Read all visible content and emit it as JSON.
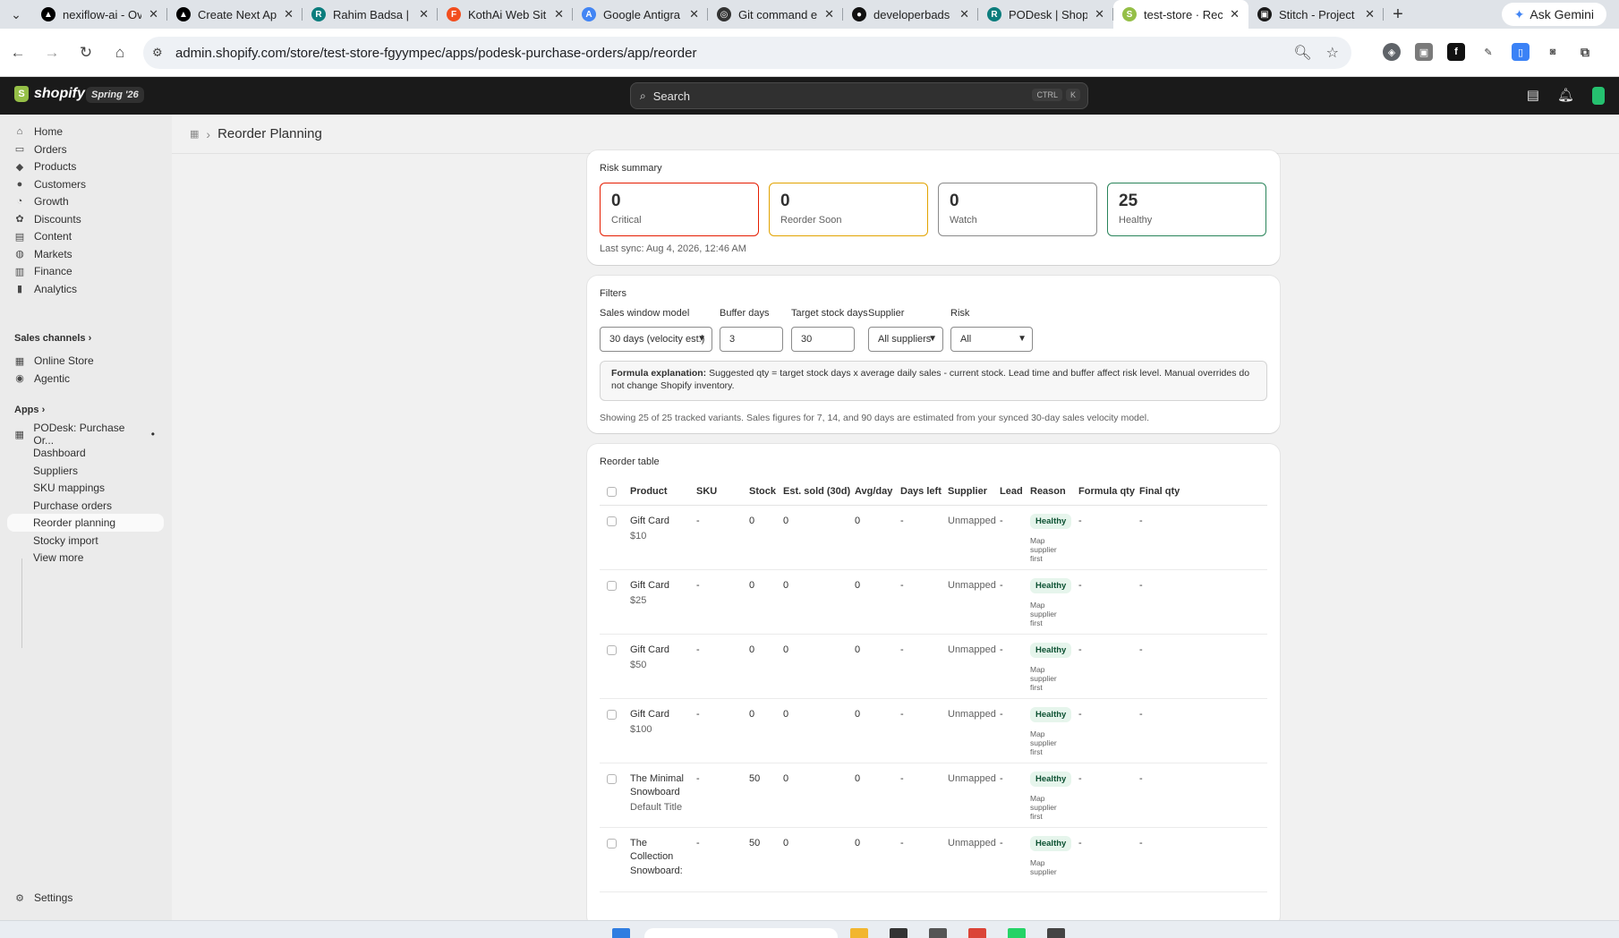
{
  "browser": {
    "tabs": [
      {
        "label": "nexiflow-ai - Ov",
        "icon": "vercel-icon",
        "color": "#000000"
      },
      {
        "label": "Create Next Ap",
        "icon": "vercel-icon",
        "color": "#000000"
      },
      {
        "label": "Rahim Badsa | F",
        "icon": "r-logo-icon",
        "color": "#0b7d7d"
      },
      {
        "label": "KothAi Web Sit",
        "icon": "figma-icon",
        "color": "#f24e1e"
      },
      {
        "label": "Google Antigra",
        "icon": "antigravity-icon",
        "color": "#4285f4"
      },
      {
        "label": "Git command e",
        "icon": "chatgpt-icon",
        "color": "#333333"
      },
      {
        "label": "developerbads",
        "icon": "github-icon",
        "color": "#111111"
      },
      {
        "label": "PODesk | Shop",
        "icon": "r-logo-icon",
        "color": "#0b7d7d"
      },
      {
        "label": "test-store · Rec",
        "icon": "shopify-icon",
        "color": "#95bf47",
        "active": true
      },
      {
        "label": "Stitch - Project",
        "icon": "stitch-icon",
        "color": "#1a1a1a"
      }
    ],
    "gemini_label": "Ask Gemini",
    "url": "admin.shopify.com/store/test-store-fgyympec/apps/podesk-purchase-orders/app/reorder"
  },
  "shopify": {
    "brand": "shopify",
    "edition": "Spring '26",
    "search_placeholder": "Search",
    "kbd": [
      "CTRL",
      "K"
    ]
  },
  "sidebar": {
    "items": [
      {
        "label": "Home",
        "icon": "home-icon"
      },
      {
        "label": "Orders",
        "icon": "orders-icon"
      },
      {
        "label": "Products",
        "icon": "tag-icon"
      },
      {
        "label": "Customers",
        "icon": "person-icon"
      },
      {
        "label": "Growth",
        "icon": "growth-icon"
      },
      {
        "label": "Discounts",
        "icon": "discount-icon"
      },
      {
        "label": "Content",
        "icon": "content-icon"
      },
      {
        "label": "Markets",
        "icon": "globe-icon"
      },
      {
        "label": "Finance",
        "icon": "bank-icon"
      },
      {
        "label": "Analytics",
        "icon": "chart-icon"
      }
    ],
    "sales_channels_label": "Sales channels",
    "channels": [
      {
        "label": "Online Store",
        "icon": "store-icon"
      },
      {
        "label": "Agentic",
        "icon": "agentic-icon"
      }
    ],
    "apps_label": "Apps",
    "app_name": "PODesk: Purchase Or...",
    "app_subitems": [
      "Dashboard",
      "Suppliers",
      "SKU mappings",
      "Purchase orders",
      "Reorder planning",
      "Stocky import",
      "View more"
    ],
    "settings_label": "Settings"
  },
  "page": {
    "title": "Reorder Planning"
  },
  "risk_summary": {
    "title": "Risk summary",
    "boxes": [
      {
        "count": "0",
        "label": "Critical",
        "color": "#e51c00"
      },
      {
        "count": "0",
        "label": "Reorder Soon",
        "color": "#e2a300"
      },
      {
        "count": "0",
        "label": "Watch",
        "color": "#8a8a8a"
      },
      {
        "count": "25",
        "label": "Healthy",
        "color": "#29845a"
      }
    ],
    "last_sync": "Last sync: Aug 4, 2026, 12:46 AM"
  },
  "filters": {
    "title": "Filters",
    "sales_window_label": "Sales window model",
    "sales_window_value": "30 days (velocity est.)",
    "buffer_label": "Buffer days",
    "buffer_value": "3",
    "target_label": "Target stock days",
    "target_value": "30",
    "supplier_label": "Supplier",
    "supplier_value": "All suppliers",
    "risk_label": "Risk",
    "risk_value": "All",
    "formula_bold": "Formula explanation:",
    "formula_text": " Suggested qty = target stock days x average daily sales - current stock. Lead time and buffer affect risk level. Manual overrides do not change Shopify inventory.",
    "showing": "Showing 25 of 25 tracked variants. Sales figures for 7, 14, and 90 days are estimated from your synced 30-day sales velocity model."
  },
  "reorder_table": {
    "title": "Reorder table",
    "columns": [
      "Product",
      "SKU",
      "Stock",
      "Est. sold (30d)",
      "Avg/day",
      "Days left",
      "Supplier",
      "Lead",
      "Reason",
      "Formula qty",
      "Final qty"
    ],
    "rows": [
      {
        "product": "Gift Card",
        "variant": "$10",
        "sku": "-",
        "stock": "0",
        "sold": "0",
        "avg": "0",
        "days_left": "-",
        "supplier": "Unmapped",
        "lead": "-",
        "reason": "Healthy",
        "reason_note": "Map supplier first",
        "formula_qty": "-",
        "final_qty": "-"
      },
      {
        "product": "Gift Card",
        "variant": "$25",
        "sku": "-",
        "stock": "0",
        "sold": "0",
        "avg": "0",
        "days_left": "-",
        "supplier": "Unmapped",
        "lead": "-",
        "reason": "Healthy",
        "reason_note": "Map supplier first",
        "formula_qty": "-",
        "final_qty": "-"
      },
      {
        "product": "Gift Card",
        "variant": "$50",
        "sku": "-",
        "stock": "0",
        "sold": "0",
        "avg": "0",
        "days_left": "-",
        "supplier": "Unmapped",
        "lead": "-",
        "reason": "Healthy",
        "reason_note": "Map supplier first",
        "formula_qty": "-",
        "final_qty": "-"
      },
      {
        "product": "Gift Card",
        "variant": "$100",
        "sku": "-",
        "stock": "0",
        "sold": "0",
        "avg": "0",
        "days_left": "-",
        "supplier": "Unmapped",
        "lead": "-",
        "reason": "Healthy",
        "reason_note": "Map supplier first",
        "formula_qty": "-",
        "final_qty": "-"
      },
      {
        "product": "The Minimal Snowboard",
        "variant": "Default Title",
        "sku": "-",
        "stock": "50",
        "sold": "0",
        "avg": "0",
        "days_left": "-",
        "supplier": "Unmapped",
        "lead": "-",
        "reason": "Healthy",
        "reason_note": "Map supplier first",
        "formula_qty": "-",
        "final_qty": "-"
      },
      {
        "product": "The Collection Snowboard:",
        "variant": "",
        "sku": "-",
        "stock": "50",
        "sold": "0",
        "avg": "0",
        "days_left": "-",
        "supplier": "Unmapped",
        "lead": "-",
        "reason": "Healthy",
        "reason_note": "Map supplier",
        "formula_qty": "-",
        "final_qty": "-"
      }
    ]
  }
}
